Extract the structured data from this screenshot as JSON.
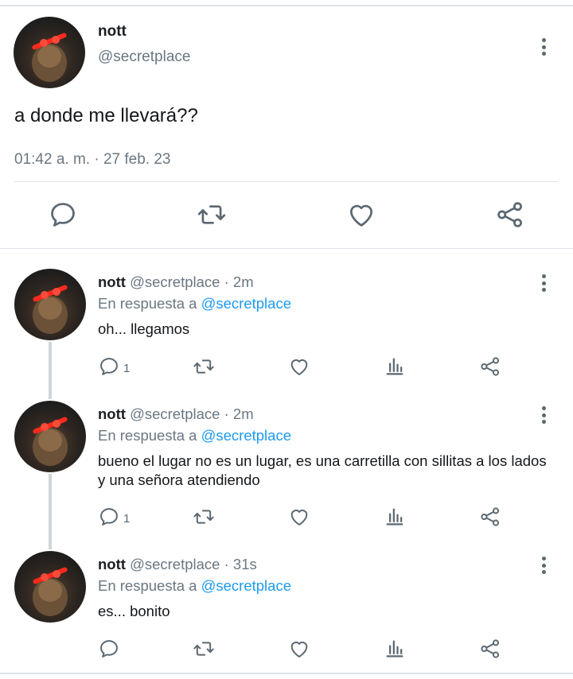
{
  "main_tweet": {
    "name": "nott",
    "handle": "@secretplace",
    "text": "a donde me llevará??",
    "meta": "01:42 a. m. · 27 feb. 23",
    "actions": [
      "reply-icon",
      "retweet-icon",
      "like-icon",
      "share-icon"
    ]
  },
  "replies": [
    {
      "name": "nott",
      "handle_time": "@secretplace · 2m",
      "in_reply_prefix": "En respuesta a ",
      "in_reply_handle": "@secretplace",
      "text": "oh... llegamos",
      "reply_count": "1"
    },
    {
      "name": "nott",
      "handle_time": "@secretplace · 2m",
      "in_reply_prefix": "En respuesta a ",
      "in_reply_handle": "@secretplace",
      "text": "bueno el lugar no es un lugar, es una carretilla con sillitas a los lados y una señora atendiendo",
      "reply_count": "1"
    },
    {
      "name": "nott",
      "handle_time": "@secretplace · 31s",
      "in_reply_prefix": "En respuesta a ",
      "in_reply_handle": "@secretplace",
      "text": "es... bonito",
      "reply_count": ""
    }
  ],
  "colors": {
    "link": "#1d9bf0",
    "secondary_text": "#6a7782",
    "icon": "#5b6770"
  }
}
